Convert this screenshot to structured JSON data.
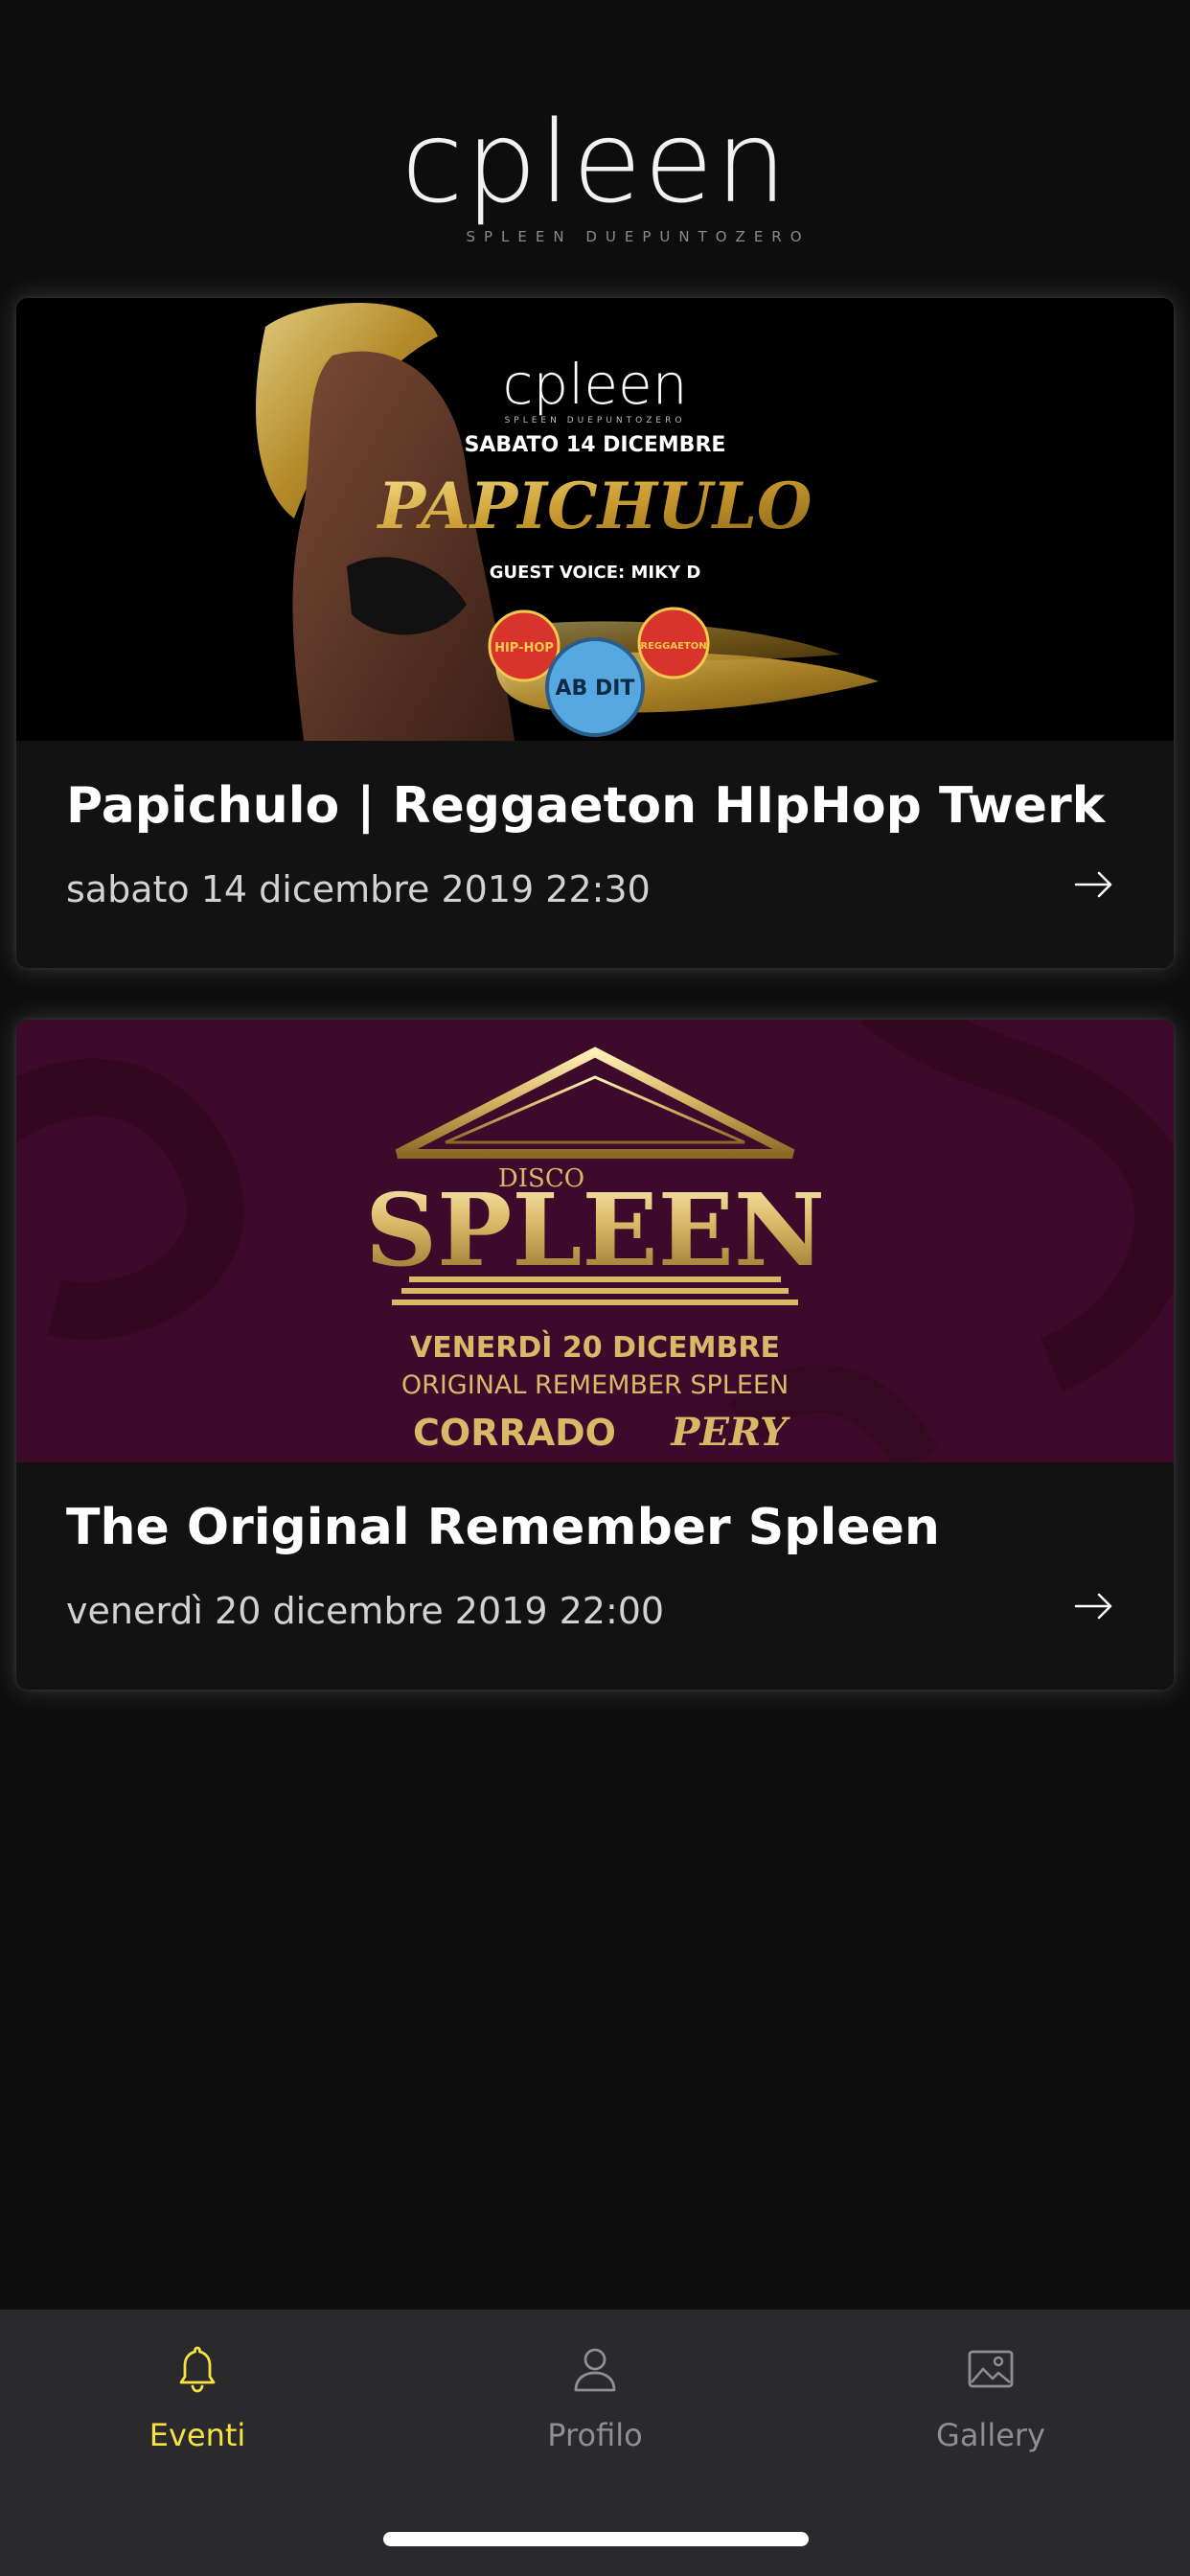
{
  "header": {
    "logo_text": "cpleen",
    "logo_tagline": "SPLEEN DUEPUNTOZERO"
  },
  "events": [
    {
      "title": "Papichulo | Reggaeton HIpHop Twerk",
      "date": "sabato 14 dicembre 2019 22:30",
      "poster": {
        "logo_text": "cpleen",
        "logo_tagline": "SPLEEN DUEPUNTOZERO",
        "date_line": "SABATO 14 DICEMBRE",
        "headline": "PAPICHULO",
        "guest": "GUEST VOICE: MIKY D",
        "badge_left": "HIP-HOP",
        "badge_right": "REGGAETON",
        "badge_center": "AB DIT",
        "accent": "#d4a72c"
      }
    },
    {
      "title": "The Original Remember Spleen",
      "date": "venerdì 20 dicembre 2019 22:00",
      "poster": {
        "small_word": "DISCO",
        "big_word": "SPLEEN",
        "date_line": "VENERDÌ 20 DICEMBRE",
        "subtitle": "ORIGINAL REMEMBER SPLEEN",
        "artist_a": "CORRADO",
        "artist_b": "PERY",
        "background": "#3d0a2c",
        "accent": "#d9b867"
      }
    }
  ],
  "tabs": [
    {
      "label": "Eventi",
      "icon": "bell-icon",
      "active": true
    },
    {
      "label": "Profilo",
      "icon": "person-icon",
      "active": false
    },
    {
      "label": "Gallery",
      "icon": "image-icon",
      "active": false
    }
  ],
  "colors": {
    "background": "#0d0d0d",
    "card": "#121212",
    "tabbar": "#2a2a2c",
    "active_tab": "#f5e342",
    "inactive_tab": "#8e8e93"
  }
}
